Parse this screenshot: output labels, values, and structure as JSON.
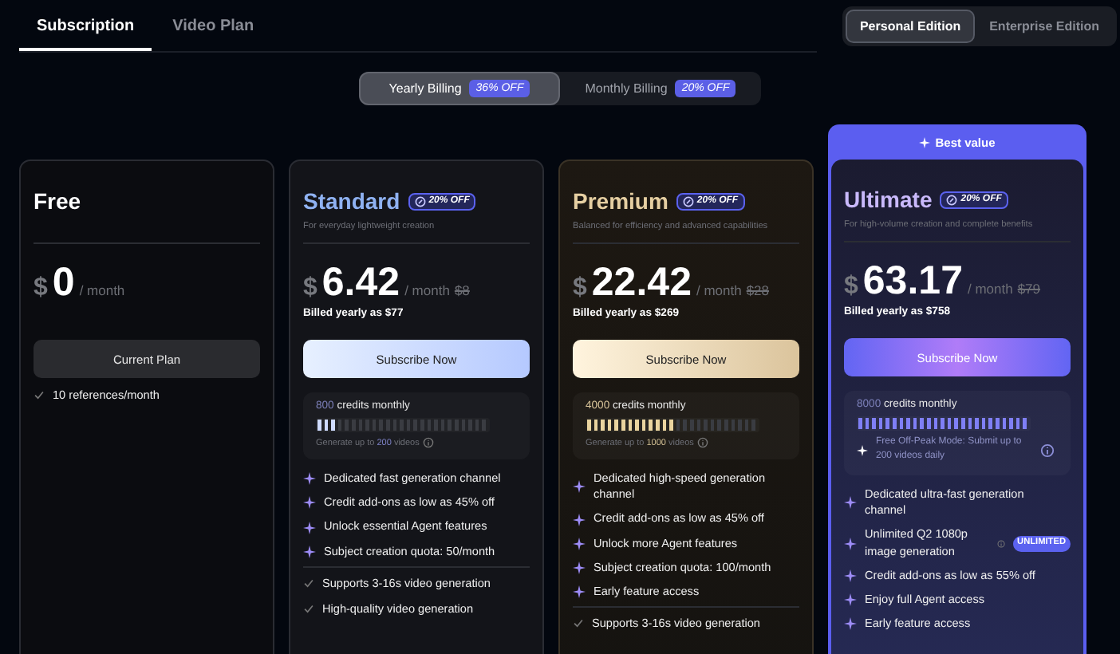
{
  "tabs": [
    {
      "label": "Subscription",
      "selected": true
    },
    {
      "label": "Video Plan",
      "selected": false
    }
  ],
  "editions": [
    {
      "label": "Personal Edition",
      "selected": true
    },
    {
      "label": "Enterprise Edition",
      "selected": false
    }
  ],
  "billing": [
    {
      "label": "Yearly Billing",
      "badge": "36% OFF",
      "selected": true
    },
    {
      "label": "Monthly Billing",
      "badge": "20% OFF",
      "selected": false
    }
  ],
  "plans": [
    {
      "kind": "free",
      "name": "Free",
      "currency": "$",
      "price": "0",
      "period": "/ month",
      "button": "Current Plan",
      "extras": [
        "10 references/month"
      ]
    },
    {
      "kind": "standard",
      "name": "Standard",
      "badge": "20% OFF",
      "subtitle": "For everyday lightweight creation",
      "currency": "$",
      "price": "6.42",
      "period": "/ month",
      "original_price": "$8",
      "billed": "Billed yearly as $77",
      "button": "Subscribe Now",
      "credits": {
        "amount": "800",
        "unit": "credits monthly",
        "level": 0.12,
        "kind": "count",
        "note_before": "Generate up to",
        "note_value": "200",
        "note_after": "videos"
      },
      "features": [
        {
          "text": "Dedicated fast generation channel"
        },
        {
          "text": "Credit add-ons as low as 45% off"
        },
        {
          "text": "Unlock essential Agent features"
        },
        {
          "text": "Subject creation quota: 50/month"
        }
      ],
      "extras": [
        "Supports 3-16s video generation",
        "High-quality video generation"
      ]
    },
    {
      "kind": "premium",
      "name": "Premium",
      "badge": "20% OFF",
      "subtitle": "Balanced for efficiency and advanced capabilities",
      "currency": "$",
      "price": "22.42",
      "period": "/ month",
      "original_price": "$28",
      "billed": "Billed yearly as $269",
      "button": "Subscribe Now",
      "credits": {
        "amount": "4000",
        "unit": "credits monthly",
        "level": 0.52,
        "kind": "count",
        "note_before": "Generate up to",
        "note_value": "1000",
        "note_after": "videos"
      },
      "features": [
        {
          "text": "Dedicated high-speed generation channel"
        },
        {
          "text": "Credit add-ons as low as 45% off"
        },
        {
          "text": "Unlock more Agent features"
        },
        {
          "text": "Subject creation quota: 100/month"
        },
        {
          "text": "Early feature access"
        }
      ],
      "extras": [
        "Supports 3-16s video generation"
      ]
    },
    {
      "kind": "ultimate",
      "name": "Ultimate",
      "ribbon": "Best value",
      "badge": "20% OFF",
      "subtitle": "For high-volume creation and complete benefits",
      "currency": "$",
      "price": "63.17",
      "period": "/ month",
      "original_price": "$79",
      "billed": "Billed yearly as $758",
      "button": "Subscribe Now",
      "credits": {
        "amount": "8000",
        "unit": "credits monthly",
        "level": 1,
        "kind": "offpeak",
        "note": "Free Off-Peak Mode: Submit up to 200 videos daily"
      },
      "features": [
        {
          "text": "Dedicated ultra-fast generation channel"
        },
        {
          "text": "Unlimited Q2 1080p image generation",
          "badge": "UNLIMITED"
        },
        {
          "text": "Credit add-ons as low as 55% off"
        },
        {
          "text": "Enjoy full Agent access"
        },
        {
          "text": "Early feature access"
        }
      ]
    }
  ]
}
